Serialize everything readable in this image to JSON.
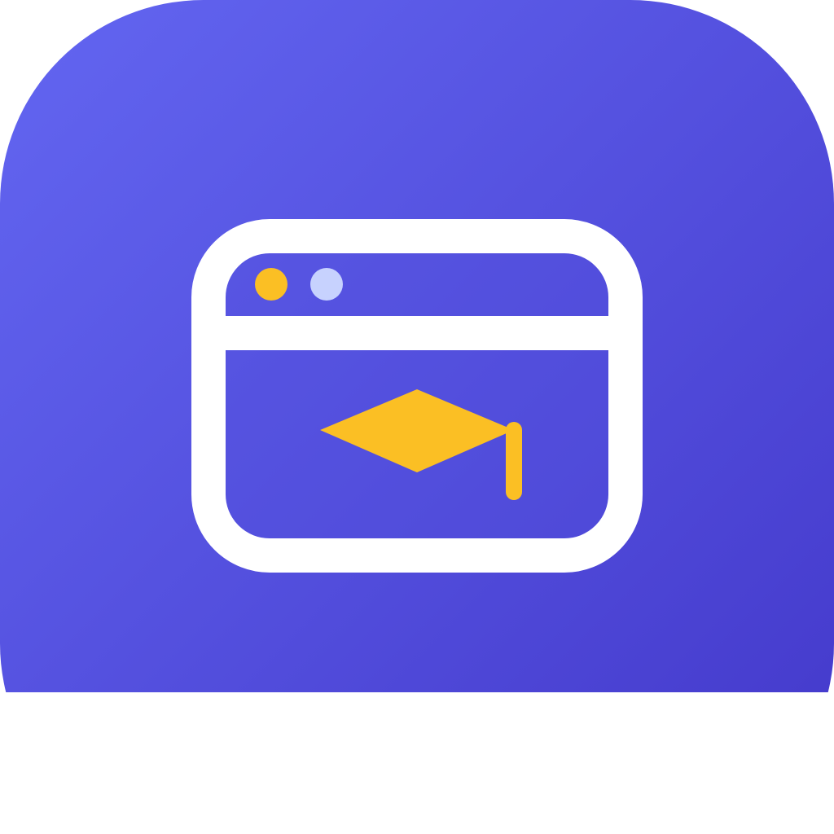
{
  "app_icon": {
    "icon_name": "online-learning-app-icon",
    "glyph": "browser-window-with-graduation-cap-icon",
    "colors": {
      "background_gradient_start": "#6366F1",
      "background_gradient_end": "#4338CA",
      "window_outline": "#FFFFFF",
      "window_fill": "#5250DE",
      "dot_primary": "#FBBF24",
      "dot_secondary": "#C7D2FE",
      "graduation_cap": "#FBBF24",
      "page_background": "#FFFFFF"
    }
  }
}
